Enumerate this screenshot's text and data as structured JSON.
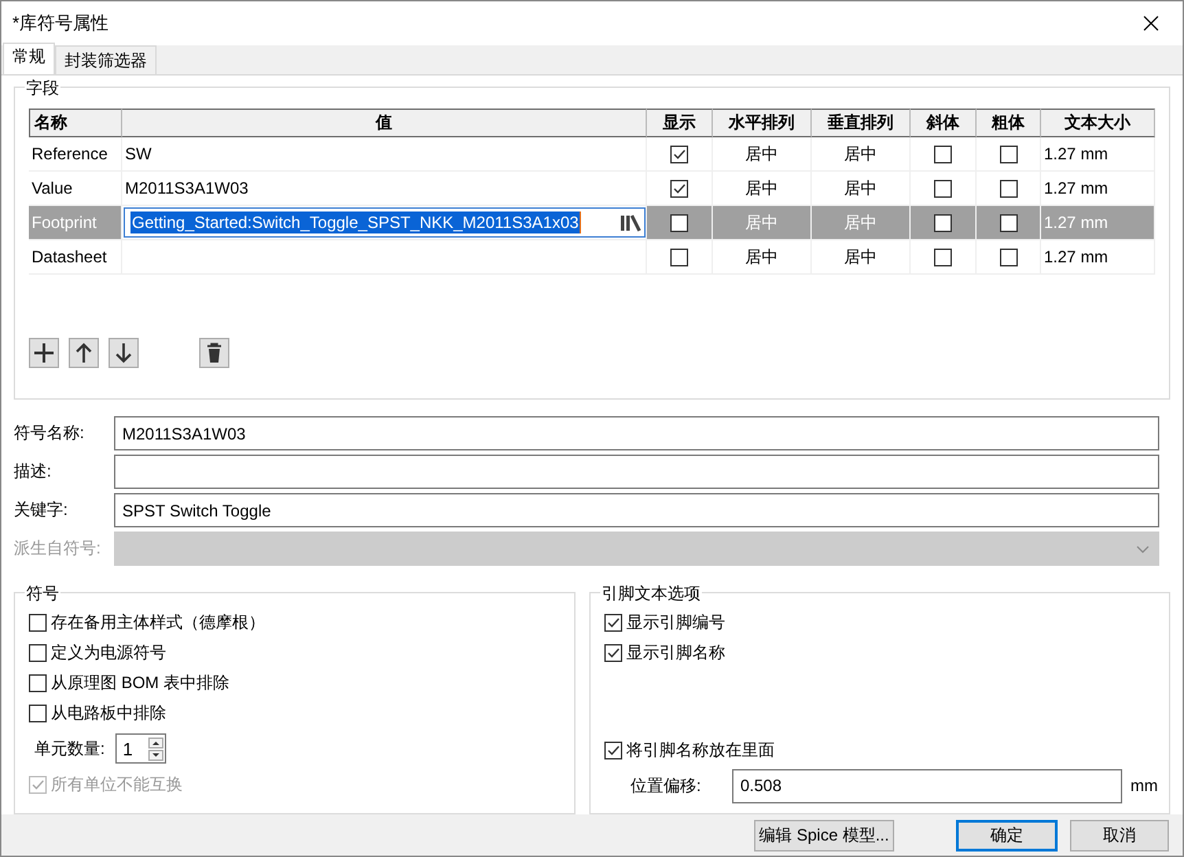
{
  "window": {
    "title": "*库符号属性"
  },
  "tabs": [
    {
      "label": "常规",
      "selected": true
    },
    {
      "label": "封装筛选器",
      "selected": false
    }
  ],
  "fields": {
    "title": "字段",
    "columns": [
      "名称",
      "值",
      "显示",
      "水平排列",
      "垂直排列",
      "斜体",
      "粗体",
      "文本大小"
    ],
    "rows": [
      {
        "name": "Reference",
        "value": "SW",
        "show": true,
        "h_align": "居中",
        "v_align": "居中",
        "italic": false,
        "bold": false,
        "text_size": "1.27 mm",
        "selected": false
      },
      {
        "name": "Value",
        "value": "M2011S3A1W03",
        "show": true,
        "h_align": "居中",
        "v_align": "居中",
        "italic": false,
        "bold": false,
        "text_size": "1.27 mm",
        "selected": false
      },
      {
        "name": "Footprint",
        "value": "Getting_Started:Switch_Toggle_SPST_NKK_M2011S3A1x03",
        "show": false,
        "h_align": "居中",
        "v_align": "居中",
        "italic": false,
        "bold": false,
        "text_size": "1.27 mm",
        "selected": true
      },
      {
        "name": "Datasheet",
        "show": false,
        "h_align": "居中",
        "v_align": "居中",
        "italic": false,
        "bold": false,
        "text_size": "1.27 mm",
        "selected": false
      }
    ]
  },
  "form": [
    {
      "kind": "text",
      "label": "符号名称:",
      "value": "M2011S3A1W03",
      "disabled": false
    },
    {
      "kind": "text",
      "label": "描述:",
      "disabled": false
    },
    {
      "kind": "text",
      "label": "关键字:",
      "value": "SPST Switch Toggle",
      "disabled": false
    },
    {
      "kind": "dropdown",
      "label": "派生自符号:",
      "disabled": true
    }
  ],
  "symbol": {
    "title": "符号",
    "items": [
      {
        "kind": "checkbox",
        "label": "存在备用主体样式（德摩根）",
        "checked": false,
        "disabled": false
      },
      {
        "kind": "checkbox",
        "label": "定义为电源符号",
        "checked": false,
        "disabled": false
      },
      {
        "kind": "checkbox",
        "label": "从原理图 BOM 表中排除",
        "checked": false,
        "disabled": false
      },
      {
        "kind": "checkbox",
        "label": "从电路板中排除",
        "checked": false,
        "disabled": false
      },
      {
        "kind": "spinner",
        "label": "单元数量:",
        "value": "1"
      },
      {
        "kind": "checkbox",
        "label": "所有单位不能互换",
        "checked": true,
        "disabled": true
      }
    ]
  },
  "pin_text": {
    "title": "引脚文本选项",
    "items": [
      {
        "kind": "checkbox",
        "label": "显示引脚编号",
        "checked": true,
        "disabled": false
      },
      {
        "kind": "checkbox",
        "label": "显示引脚名称",
        "checked": true,
        "disabled": false
      },
      {
        "kind": "spacer"
      },
      {
        "kind": "checkbox",
        "label": "将引脚名称放在里面",
        "checked": true,
        "disabled": false
      },
      {
        "kind": "offset",
        "label": "位置偏移:",
        "value": "0.508",
        "unit": "mm"
      }
    ]
  },
  "buttons": [
    {
      "label": "编辑 Spice 模型...",
      "default": false
    },
    {
      "label": "确定",
      "default": true
    },
    {
      "label": "取消",
      "default": false
    }
  ]
}
